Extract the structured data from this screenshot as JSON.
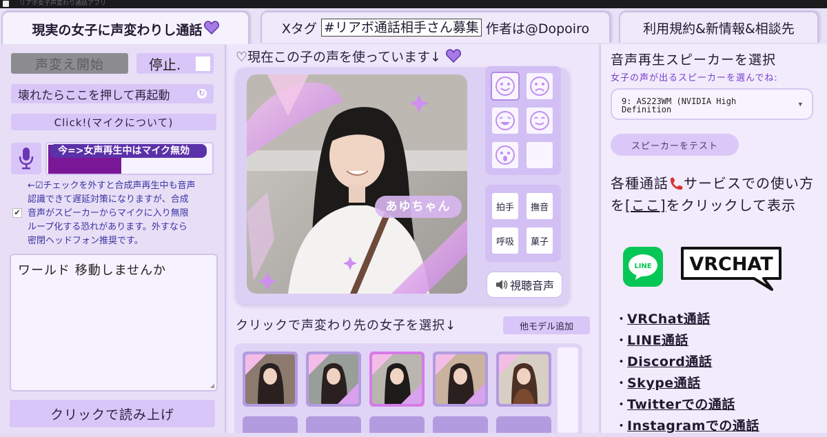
{
  "window": {
    "title": "リアボ女子声変わり通話アプリ"
  },
  "tabs": {
    "tab1_label": "現実の女子に声変わりし通話",
    "tab1_heart": "♡",
    "tab2_prefix": "Xタグ",
    "tab2_tag": "#リアボ通話相手さん募集",
    "tab2_suffix": "作者は@Dopoiro",
    "tab3_label": "利用規約&新情報&相談先"
  },
  "left": {
    "start_label": "声変え開始",
    "stop_label": "停止.",
    "restart_label": "壊れたらここを押して再起動",
    "click_label": "Click!(マイクについて)",
    "meter_label": "今=>女声再生中はマイク無効",
    "meter_level": 0.45,
    "note_lines": [
      "←☑チェックを外すと合成声再生中も音声",
      "認識できて遅延対策になりますが、合成",
      "音声がスピーカーからマイクに入り無限",
      "ループ化する恐れがあります。外すなら",
      "密閉ヘッドフォン推奨です。"
    ],
    "note_check": "✔",
    "textarea_value": "ワールド 移動しませんか",
    "read_label": "クリックで読み上げ"
  },
  "mid": {
    "current_title": "♡現在この子の声を使っています↓",
    "current_heart": "♡",
    "name_tag": "あゆちゃん",
    "faces": [
      "happy-face-icon",
      "sad-face-icon",
      "laugh-face-icon",
      "smile-face-icon",
      "surprised-face-icon",
      ""
    ],
    "actions": [
      "拍手",
      "撫音",
      "呼吸",
      "菓子"
    ],
    "listen_label": "視聴音声",
    "select_title": "クリックで声変わり先の女子を選択↓",
    "add_model_label": "他モデル追加"
  },
  "right": {
    "title": "音声再生スピーカーを選択",
    "subtitle": "女子の声が出るスピーカーを選んでね:",
    "speaker_value": "9: AS223WM (NVIDIA High Definition",
    "test_label": "スピーカーをテスト",
    "howto_a": "各種通話",
    "howto_b": "サービスでの使い方を",
    "howto_link": "[ここ]",
    "howto_c": "をクリックして表示",
    "line_logo": "LINE",
    "vrchat_logo": "VRCHAT",
    "links": [
      "VRChat通話",
      "LINE通話",
      "Discord通話",
      "Skype通話",
      "Twitterでの通話",
      "Instagramでの通話"
    ],
    "bullet": "・"
  },
  "colors": {
    "accent": "#8a55d6",
    "button": "#d9c6f8",
    "meter": "#7a1796",
    "line_green": "#06c755"
  }
}
